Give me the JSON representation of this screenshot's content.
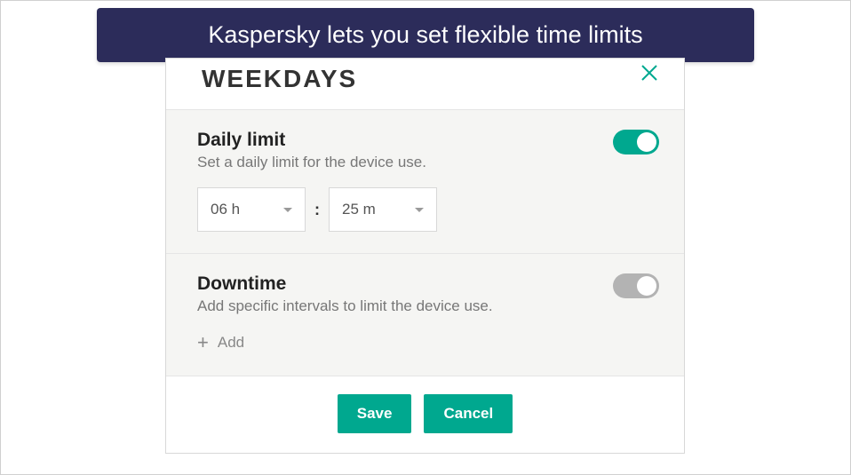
{
  "banner": {
    "text": "Kaspersky lets you set flexible time limits"
  },
  "panel": {
    "title": "WEEKDAYS",
    "daily_limit": {
      "title": "Daily limit",
      "description": "Set a daily limit for the device use.",
      "enabled": true,
      "hours": "06 h",
      "minutes": "25 m",
      "separator": ":"
    },
    "downtime": {
      "title": "Downtime",
      "description": "Add specific intervals to limit the device use.",
      "enabled": false,
      "add_label": "Add"
    },
    "actions": {
      "save": "Save",
      "cancel": "Cancel"
    }
  },
  "colors": {
    "accent": "#00a88f",
    "banner_bg": "#2c2c5a"
  }
}
